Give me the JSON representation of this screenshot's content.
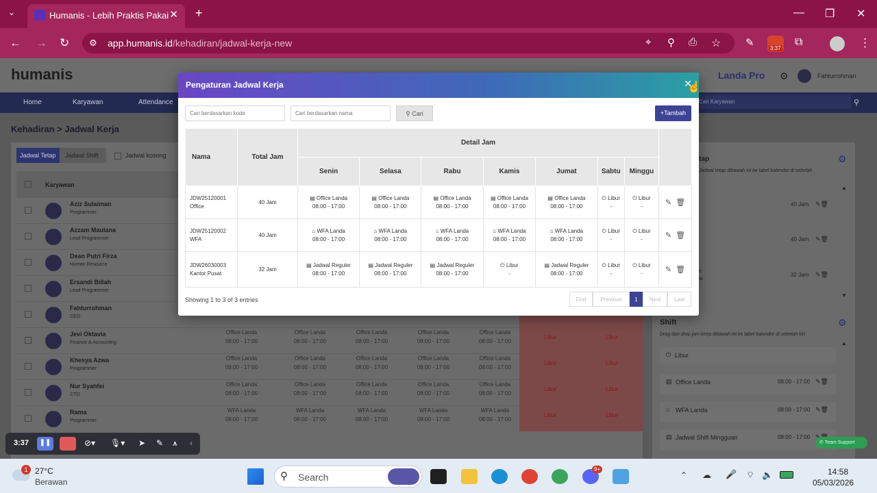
{
  "browser": {
    "tab_title": "Humanis - Lebih Praktis Pakai H",
    "url_host": "app.humanis.id",
    "url_path": "/kehadiran/jadwal-kerja-new",
    "ext_badge": "3:37"
  },
  "app": {
    "logo": "humanis",
    "company": "Landa Pro",
    "user": "Fahturrohman",
    "menu": [
      "Home",
      "Karyawan",
      "Attendance"
    ],
    "search_employee": "Cari Karyawan",
    "breadcrumb": "Kehadiran > Jadwal Kerja",
    "tabs": [
      "Jadwal Tetap",
      "Jadwal Shift"
    ],
    "empty_label": "Jadwal kosong",
    "col_karyawan": "Karyawan",
    "employees": [
      {
        "name": "Aziz Sulaiman",
        "role": "Programmer"
      },
      {
        "name": "Azzam Maulana",
        "role": "Lead Programmer"
      },
      {
        "name": "Dean Putri Firza",
        "role": "Human Resource"
      },
      {
        "name": "Ersandi Billah",
        "role": "Lead Programmer"
      },
      {
        "name": "Fahturrohman",
        "role": "CEO"
      },
      {
        "name": "Jevi Oktavia",
        "role": "Finance & Accounting"
      },
      {
        "name": "Khesya Azwa",
        "role": "Programmer"
      },
      {
        "name": "Nur Syahfei",
        "role": "CTO"
      },
      {
        "name": "Rama",
        "role": "Programmer"
      }
    ],
    "bg_time": "08:00 - 17:00",
    "bg_office": "Office Landa",
    "bg_wfa": "WFA Landa",
    "bg_libur": "Libur",
    "right_top_title": "tap",
    "right_top_desc": "Jadwal tetap dibawah ini ke tabel kalendor di sebelah",
    "right_items": [
      {
        "hours": "40 Jam"
      },
      {
        "hours": "40 Jam"
      },
      {
        "hours": "32 Jam"
      }
    ],
    "right_item3_sub": "e\nat",
    "shift_title": "Shift",
    "shift_desc": "Drag dan drop jam kerja dibawah ini ke tabel kalondor di sebelah kiri",
    "shift_items": [
      {
        "label": "Libur",
        "time": ""
      },
      {
        "label": "Office Landa",
        "time": "08:00 - 17:00"
      },
      {
        "label": "WFA Landa",
        "time": "08:00 - 17:00"
      },
      {
        "label": "Jadwal Shift Mingguan",
        "time": "08:00 - 17:00"
      }
    ],
    "team_support": "Team Support"
  },
  "modal": {
    "title": "Pengaturan Jadwal Kerja",
    "code_placeholder": "Cari berdasarkan kode",
    "name_placeholder": "Cari berdasarkan nama",
    "search_btn": "Cari",
    "add_btn": "+Tambah",
    "headers": {
      "nama": "Nama",
      "total": "Total Jam",
      "detail": "Detail Jam",
      "days": [
        "Senin",
        "Selasa",
        "Rabu",
        "Kamis",
        "Jumat",
        "Sabtu",
        "Minggu"
      ]
    },
    "rows": [
      {
        "code": "JDW25120001",
        "name": "Office",
        "total": "40 Jam",
        "days": [
          [
            "Office Landa",
            "08:00 - 17:00"
          ],
          [
            "Office Landa",
            "08:00 - 17:00"
          ],
          [
            "Office Landa",
            "08:00 - 17:00"
          ],
          [
            "Office Landa",
            "08:00 - 17:00"
          ],
          [
            "Office Landa",
            "08:00 - 17:00"
          ],
          [
            "Libur",
            "-"
          ],
          [
            "Libur",
            "-"
          ]
        ]
      },
      {
        "code": "JDW25120002",
        "name": "WFA",
        "total": "40 Jam",
        "days": [
          [
            "WFA Landa",
            "08:00 - 17:00"
          ],
          [
            "WFA Landa",
            "08:00 - 17:00"
          ],
          [
            "WFA Landa",
            "08:00 - 17:00"
          ],
          [
            "WFA Landa",
            "08:00 - 17:00"
          ],
          [
            "WFA Landa",
            "08:00 - 17:00"
          ],
          [
            "Libur",
            "-"
          ],
          [
            "Libur",
            "-"
          ]
        ]
      },
      {
        "code": "JDW26030003",
        "name": "Kantor Pusat",
        "total": "32 Jam",
        "days": [
          [
            "Jadwal Reguler",
            "08:00 - 17:00"
          ],
          [
            "Jadwal Reguler",
            "08:00 - 17:00"
          ],
          [
            "Jadwal Reguler",
            "08:00 - 17:00"
          ],
          [
            "Libur",
            "-"
          ],
          [
            "Jadwal Reguler",
            "08:00 - 17:00"
          ],
          [
            "Libur",
            "-"
          ],
          [
            "Libur",
            "-"
          ]
        ]
      }
    ],
    "showing": "Showing 1 to 3 of 3 entries",
    "pager": [
      "First",
      "Previous",
      "1",
      "Next",
      "Last"
    ]
  },
  "recorder": {
    "time": "3:37"
  },
  "taskbar": {
    "weather_temp": "27°C",
    "weather_desc": "Berawan",
    "weather_badge": "1",
    "search": "Search",
    "discord_badge": "9+",
    "time": "14:58",
    "date": "05/03/2026"
  }
}
